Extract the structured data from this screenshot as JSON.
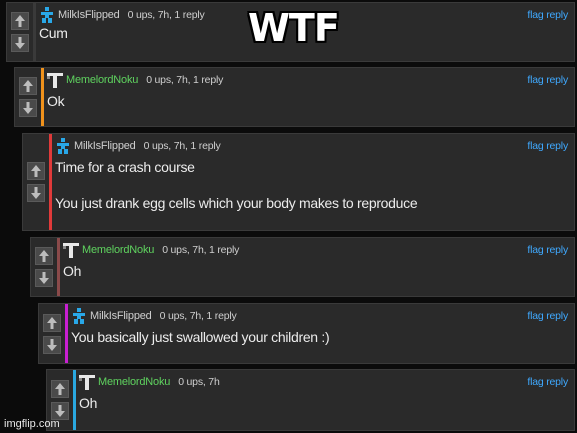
{
  "meme_title": "WTF",
  "watermark": "imgflip.com",
  "comments": [
    {
      "username": "MilkIsFlipped",
      "meta": "0 ups, 7h, 1 reply",
      "text": [
        "Cum"
      ],
      "flag": "flag",
      "reply": "reply",
      "bar_color": "#3a3a3a",
      "name_color": "#cfcfcf",
      "avatar": "milk-avatar-icon"
    },
    {
      "username": "MemelordNoku",
      "meta": "0 ups, 7h, 1 reply",
      "text": [
        "Ok"
      ],
      "flag": "flag",
      "reply": "reply",
      "bar_color": "#f0921c",
      "name_color": "#5fd35f",
      "avatar": "memelord-avatar-icon"
    },
    {
      "username": "MilkIsFlipped",
      "meta": "0 ups, 7h, 1 reply",
      "text": [
        "Time for a crash course",
        "You just drank egg cells which your body makes to reproduce"
      ],
      "flag": "flag",
      "reply": "reply",
      "bar_color": "#e03a3a",
      "name_color": "#cfcfcf",
      "avatar": "milk-avatar-icon"
    },
    {
      "username": "MemelordNoku",
      "meta": "0 ups, 7h, 1 reply",
      "text": [
        "Oh"
      ],
      "flag": "flag",
      "reply": "reply",
      "bar_color": "#8a4a4a",
      "name_color": "#5fd35f",
      "avatar": "memelord-avatar-icon"
    },
    {
      "username": "MilkIsFlipped",
      "meta": "0 ups, 7h, 1 reply",
      "text": [
        "You basically just swallowed your children :)"
      ],
      "flag": "flag",
      "reply": "reply",
      "bar_color": "#c81fd1",
      "name_color": "#cfcfcf",
      "avatar": "milk-avatar-icon"
    },
    {
      "username": "MemelordNoku",
      "meta": "0 ups, 7h",
      "text": [
        "Oh"
      ],
      "flag": "flag",
      "reply": "reply",
      "bar_color": "#2aa8e0",
      "name_color": "#5fd35f",
      "avatar": "memelord-avatar-icon"
    }
  ]
}
